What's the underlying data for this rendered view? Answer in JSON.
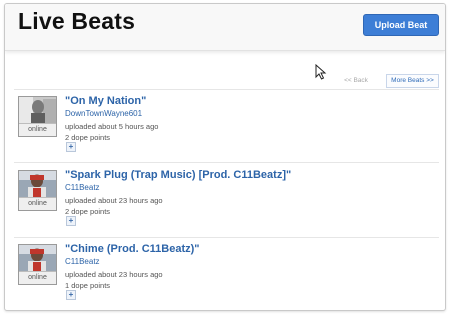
{
  "header": {
    "title": "Live Beats",
    "upload_label": "Upload Beat"
  },
  "pager": {
    "back_label": "<< Back",
    "more_label": "More Beats >>"
  },
  "beats": [
    {
      "title": "\"On My Nation\"",
      "user": "DownTownWayne601",
      "uploaded": "uploaded about 5 hours ago",
      "points": "2 dope points",
      "status": "online",
      "plus_label": "+"
    },
    {
      "title": "\"Spark Plug (Trap Music) [Prod. C11Beatz]\"",
      "user": "C11Beatz",
      "uploaded": "uploaded about 23 hours ago",
      "points": "2 dope points",
      "status": "online",
      "plus_label": "+"
    },
    {
      "title": "\"Chime (Prod. C11Beatz)\"",
      "user": "C11Beatz",
      "uploaded": "uploaded about 23 hours ago",
      "points": "1 dope points",
      "status": "online",
      "plus_label": "+"
    }
  ],
  "colors": {
    "accent_blue": "#3d7ed6",
    "link_blue": "#2d64a8"
  }
}
